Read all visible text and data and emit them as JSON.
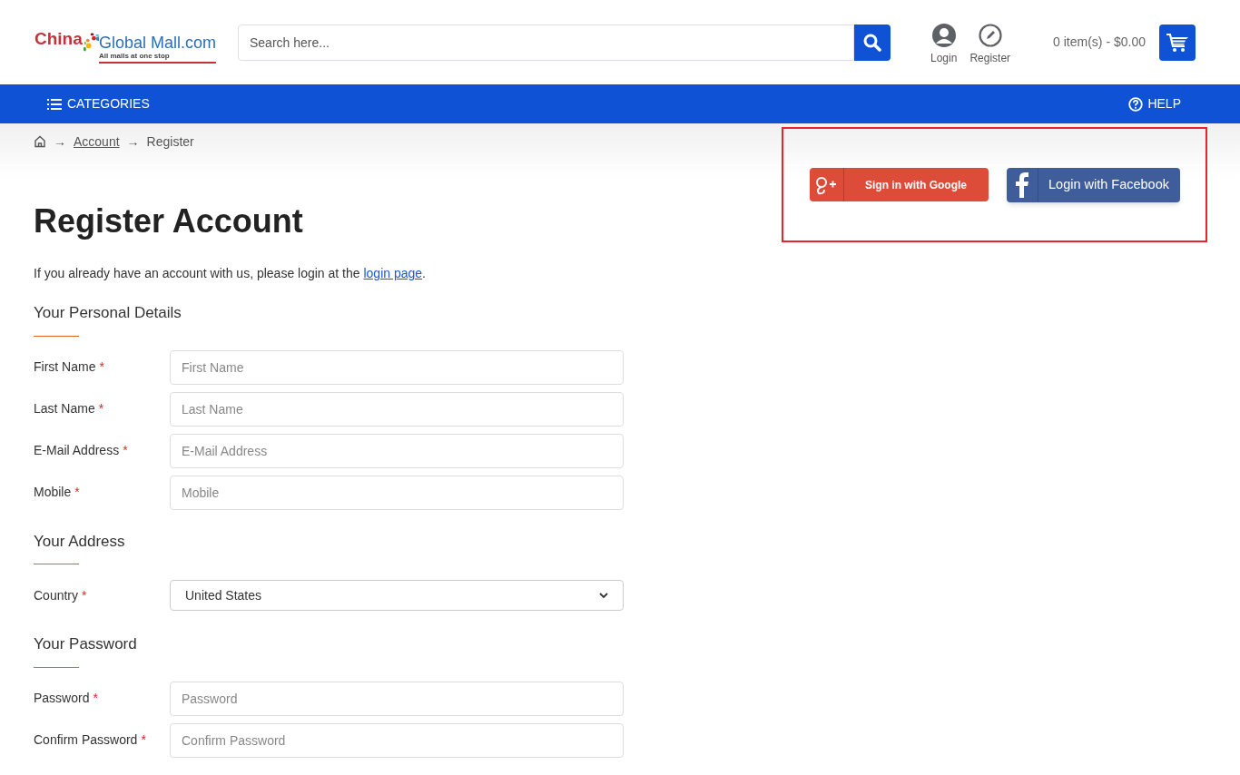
{
  "logo": {
    "word1": "China",
    "word2": "Global Mall.com",
    "tagline": "All malls at one stop"
  },
  "search": {
    "placeholder": "Search here..."
  },
  "account_links": [
    {
      "kind": "user",
      "label": "Login"
    },
    {
      "kind": "pencil",
      "label": "Register"
    }
  ],
  "cart": {
    "summary": "0 item(s) - $0.00"
  },
  "nav": {
    "categories": "CATEGORIES",
    "help": "HELP"
  },
  "breadcrumb": {
    "separators": [
      "→",
      "→"
    ],
    "links": [
      "Account"
    ],
    "current": "Register"
  },
  "social_buttons": [
    {
      "kind": "google",
      "label": "Sign in with Google"
    },
    {
      "kind": "facebook",
      "label": "Login with Facebook"
    }
  ],
  "title": "Register Account",
  "intro": {
    "before": "If you already have an account with us, please login at the ",
    "link": "login page",
    "after": "."
  },
  "sections": [
    {
      "heading": "Your Personal Details",
      "fields": [
        {
          "kind": "text",
          "label": "First Name",
          "marker": "*",
          "placeholder": "First Name"
        },
        {
          "kind": "text",
          "label": "Last Name",
          "marker": "*",
          "placeholder": "Last Name"
        },
        {
          "kind": "text",
          "label": "E-Mail Address",
          "marker": "*",
          "placeholder": "E-Mail Address"
        },
        {
          "kind": "text",
          "label": "Mobile",
          "marker": "*",
          "placeholder": "Mobile"
        }
      ]
    },
    {
      "heading": "Your Address",
      "fields": [
        {
          "kind": "select",
          "label": "Country",
          "marker": "*",
          "value": "United States"
        }
      ]
    },
    {
      "heading": "Your Password",
      "fields": [
        {
          "kind": "text",
          "label": "Password",
          "marker": "*",
          "placeholder": "Password"
        },
        {
          "kind": "text",
          "label": "Confirm Password",
          "marker": "*",
          "placeholder": "Confirm Password"
        }
      ]
    }
  ]
}
